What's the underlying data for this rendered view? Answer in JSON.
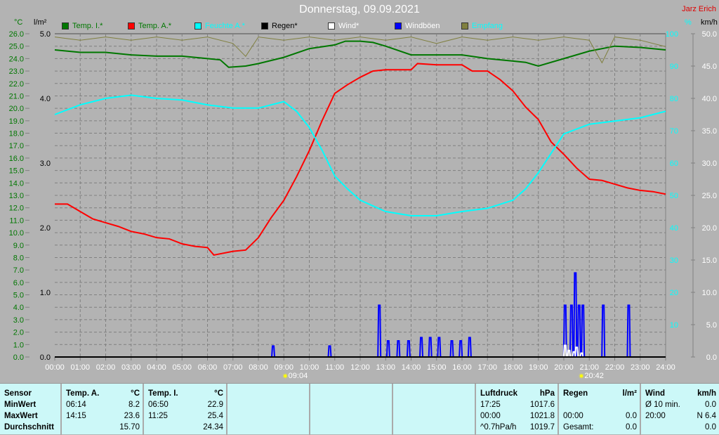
{
  "header": {
    "title": "Donnerstag, 09.09.2021",
    "author": "Jarz Erich"
  },
  "units": {
    "temp": "°C",
    "rain": "l/m²",
    "hum": "%",
    "wind": "km/h"
  },
  "legend": [
    {
      "label": "Temp. I.*",
      "color": "#007700",
      "text": "#007700"
    },
    {
      "label": "Temp. A.*",
      "color": "#ff0000",
      "text": "#007700"
    },
    {
      "label": "Feuchte A.*",
      "color": "#00ffff",
      "text": "#00ffff"
    },
    {
      "label": "Regen*",
      "color": "#000000",
      "text": "#000000"
    },
    {
      "label": "Wind*",
      "color": "#ffffff",
      "text": "#ffffff"
    },
    {
      "label": "Windböen",
      "color": "#0000ff",
      "text": "#ffffff"
    },
    {
      "label": "Empfang",
      "color": "#808040",
      "text": "#00ffff"
    }
  ],
  "chart_data": {
    "type": "line",
    "title": "Donnerstag, 09.09.2021",
    "x_ticks": [
      "00:00",
      "01:00",
      "02:00",
      "03:00",
      "04:00",
      "05:00",
      "06:00",
      "07:00",
      "08:00",
      "09:00",
      "10:00",
      "11:00",
      "12:00",
      "13:00",
      "14:00",
      "15:00",
      "16:00",
      "17:00",
      "18:00",
      "19:00",
      "20:00",
      "21:00",
      "22:00",
      "23:00",
      "24:00"
    ],
    "temp_ticks": [
      "0.0",
      "1.0",
      "2.0",
      "3.0",
      "4.0",
      "5.0",
      "6.0",
      "7.0",
      "8.0",
      "9.0",
      "10.0",
      "11.0",
      "12.0",
      "13.0",
      "14.0",
      "15.0",
      "16.0",
      "17.0",
      "18.0",
      "19.0",
      "20.0",
      "21.0",
      "22.0",
      "23.0",
      "24.0",
      "25.0",
      "26.0"
    ],
    "rain_ticks": [
      "0.0",
      "1.0",
      "2.0",
      "3.0",
      "4.0",
      "5.0"
    ],
    "hum_ticks": [
      "0",
      "10",
      "20",
      "30",
      "40",
      "50",
      "60",
      "70",
      "80",
      "90",
      "100"
    ],
    "wind_ticks": [
      "0.0",
      "5.0",
      "10.0",
      "15.0",
      "20.0",
      "25.0",
      "30.0",
      "35.0",
      "40.0",
      "45.0",
      "50.0"
    ],
    "ylim_temp": [
      0,
      26
    ],
    "ylim_rain": [
      0,
      5
    ],
    "ylim_hum": [
      0,
      100
    ],
    "ylim_wind": [
      0,
      50
    ],
    "sunrise": "09:04",
    "sunset": "20:42",
    "series": [
      {
        "name": "Temp. A.*",
        "axis": "temp",
        "color": "#ff0000",
        "points": [
          [
            0,
            12.3
          ],
          [
            0.5,
            12.3
          ],
          [
            1,
            11.7
          ],
          [
            1.5,
            11.1
          ],
          [
            2,
            10.8
          ],
          [
            2.5,
            10.5
          ],
          [
            3,
            10.1
          ],
          [
            3.5,
            9.9
          ],
          [
            4,
            9.6
          ],
          [
            4.5,
            9.5
          ],
          [
            5,
            9.1
          ],
          [
            5.5,
            8.9
          ],
          [
            6,
            8.8
          ],
          [
            6.25,
            8.2
          ],
          [
            7,
            8.5
          ],
          [
            7.5,
            8.6
          ],
          [
            8,
            9.6
          ],
          [
            8.5,
            11.2
          ],
          [
            9,
            12.6
          ],
          [
            9.5,
            14.5
          ],
          [
            10,
            16.6
          ],
          [
            10.5,
            19.0
          ],
          [
            11,
            21.2
          ],
          [
            11.5,
            21.9
          ],
          [
            12,
            22.5
          ],
          [
            12.5,
            23.0
          ],
          [
            13,
            23.1
          ],
          [
            14,
            23.1
          ],
          [
            14.25,
            23.6
          ],
          [
            15,
            23.5
          ],
          [
            16,
            23.5
          ],
          [
            16.4,
            23.0
          ],
          [
            17,
            23.0
          ],
          [
            17.5,
            22.3
          ],
          [
            18,
            21.4
          ],
          [
            18.5,
            20.1
          ],
          [
            19,
            19.1
          ],
          [
            19.5,
            17.3
          ],
          [
            20,
            16.3
          ],
          [
            20.5,
            15.2
          ],
          [
            21,
            14.3
          ],
          [
            21.5,
            14.2
          ],
          [
            22,
            13.9
          ],
          [
            22.5,
            13.6
          ],
          [
            23,
            13.4
          ],
          [
            23.5,
            13.3
          ],
          [
            24,
            13.1
          ]
        ]
      },
      {
        "name": "Temp. I.*",
        "axis": "temp",
        "color": "#007700",
        "points": [
          [
            0,
            24.7
          ],
          [
            1,
            24.5
          ],
          [
            2,
            24.5
          ],
          [
            3,
            24.3
          ],
          [
            4,
            24.2
          ],
          [
            5,
            24.2
          ],
          [
            6,
            24.0
          ],
          [
            6.5,
            23.9
          ],
          [
            6.83,
            23.3
          ],
          [
            7.5,
            23.4
          ],
          [
            8,
            23.6
          ],
          [
            9,
            24.1
          ],
          [
            10,
            24.8
          ],
          [
            11,
            25.1
          ],
          [
            11.42,
            25.4
          ],
          [
            12,
            25.4
          ],
          [
            12.5,
            25.3
          ],
          [
            13,
            25.0
          ],
          [
            14,
            24.3
          ],
          [
            15,
            24.3
          ],
          [
            16,
            24.3
          ],
          [
            17,
            24.0
          ],
          [
            18,
            23.8
          ],
          [
            18.5,
            23.7
          ],
          [
            19,
            23.4
          ],
          [
            20,
            24.0
          ],
          [
            21,
            24.6
          ],
          [
            22,
            25.0
          ],
          [
            23,
            24.9
          ],
          [
            24,
            24.7
          ]
        ]
      },
      {
        "name": "Feuchte A.*",
        "axis": "hum",
        "color": "#00ffff",
        "points": [
          [
            0,
            75
          ],
          [
            1,
            78
          ],
          [
            2,
            80
          ],
          [
            3,
            81
          ],
          [
            4,
            80
          ],
          [
            5,
            79.5
          ],
          [
            6,
            78
          ],
          [
            7,
            77
          ],
          [
            8,
            77
          ],
          [
            9,
            79
          ],
          [
            9.5,
            76
          ],
          [
            10,
            71
          ],
          [
            10.5,
            64
          ],
          [
            11,
            56
          ],
          [
            11.5,
            52
          ],
          [
            12,
            48.5
          ],
          [
            13,
            45
          ],
          [
            14,
            43.7
          ],
          [
            15,
            43.7
          ],
          [
            16,
            45
          ],
          [
            17,
            46
          ],
          [
            18,
            48.5
          ],
          [
            18.5,
            52
          ],
          [
            19,
            57
          ],
          [
            19.5,
            63
          ],
          [
            20,
            69
          ],
          [
            21,
            72
          ],
          [
            22,
            73
          ],
          [
            23,
            74
          ],
          [
            24,
            76
          ]
        ]
      },
      {
        "name": "Empfang",
        "axis": "hum",
        "color": "#808040",
        "points": [
          [
            0,
            99
          ],
          [
            1,
            98
          ],
          [
            2,
            99
          ],
          [
            3,
            98
          ],
          [
            4,
            99
          ],
          [
            5,
            98
          ],
          [
            6,
            99
          ],
          [
            7,
            97
          ],
          [
            7.5,
            93
          ],
          [
            8,
            99
          ],
          [
            9,
            98
          ],
          [
            10,
            99
          ],
          [
            11,
            98
          ],
          [
            12,
            99
          ],
          [
            13,
            98
          ],
          [
            14,
            99
          ],
          [
            15,
            97
          ],
          [
            16,
            99
          ],
          [
            17,
            98
          ],
          [
            18,
            99
          ],
          [
            19,
            98
          ],
          [
            20,
            99
          ],
          [
            21,
            98
          ],
          [
            21.5,
            91
          ],
          [
            22,
            99
          ],
          [
            23,
            98
          ],
          [
            24,
            96
          ]
        ]
      },
      {
        "name": "Windböen",
        "axis": "wind",
        "color": "#0000ff",
        "bars": [
          [
            8.58,
            1.7
          ],
          [
            10.8,
            1.7
          ],
          [
            12.75,
            8.0
          ],
          [
            13.1,
            2.5
          ],
          [
            13.5,
            2.5
          ],
          [
            13.9,
            2.5
          ],
          [
            14.4,
            3.0
          ],
          [
            14.75,
            3.0
          ],
          [
            15.1,
            3.0
          ],
          [
            15.6,
            2.5
          ],
          [
            15.95,
            2.5
          ],
          [
            16.3,
            3.0
          ],
          [
            20.05,
            8.0
          ],
          [
            20.3,
            8.0
          ],
          [
            20.45,
            13.0
          ],
          [
            20.6,
            8.0
          ],
          [
            20.75,
            8.0
          ],
          [
            21.55,
            8.0
          ],
          [
            22.55,
            8.0
          ]
        ]
      },
      {
        "name": "Wind*",
        "axis": "wind",
        "color": "#ffffff",
        "bars": [
          [
            20.05,
            1.8
          ],
          [
            20.2,
            1.0
          ],
          [
            20.4,
            0.8
          ],
          [
            20.5,
            1.5
          ],
          [
            20.7,
            0.6
          ]
        ]
      }
    ]
  },
  "table": {
    "sensor": {
      "h": "Sensor",
      "r1": "MinWert",
      "r2": "MaxWert",
      "r3": "Durchschnitt"
    },
    "tempA": {
      "h": "Temp. A.",
      "u": "°C",
      "min_t": "06:14",
      "min": "8.2",
      "max_t": "14:15",
      "max": "23.6",
      "avg": "15.70"
    },
    "tempI": {
      "h": "Temp. I.",
      "u": "°C",
      "min_t": "06:50",
      "min": "22.9",
      "max_t": "11:25",
      "max": "25.4",
      "avg": "24.34"
    },
    "press": {
      "h": "Luftdruck",
      "u": "hPa",
      "a_t": "17:25",
      "a": "1017.6",
      "b_t": "00:00",
      "b": "1021.8",
      "c_t": "^0.7hPa/h",
      "c": "1019.7"
    },
    "rain": {
      "h": "Regen",
      "u": "l/m²",
      "b_t": "00:00",
      "b": "0.0",
      "c_t": "Gesamt:",
      "c": "0.0"
    },
    "wind": {
      "h": "Wind",
      "u": "km/h",
      "a_t": "Ø 10 min.",
      "a": "0.0",
      "b_t": "20:00",
      "b": "N 6.4",
      "c": "0.0"
    }
  }
}
